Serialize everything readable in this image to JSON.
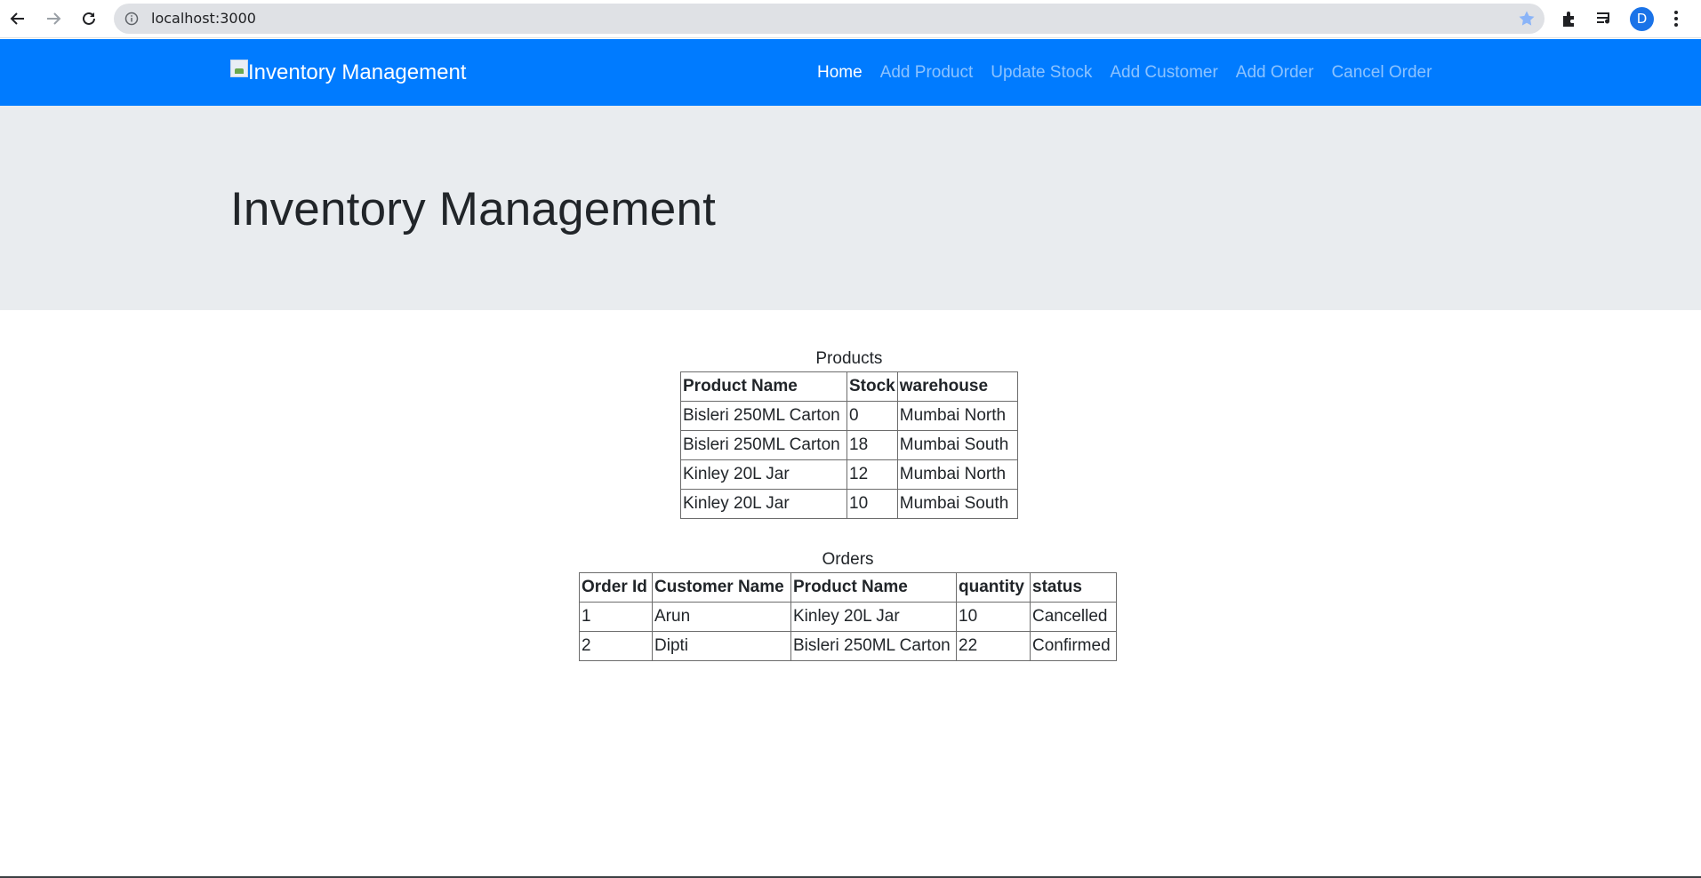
{
  "browser": {
    "url": "localhost:3000",
    "profile_initial": "D"
  },
  "navbar": {
    "brand_alt": "Inventory Management",
    "links": [
      {
        "label": "Home",
        "active": true
      },
      {
        "label": "Add Product",
        "active": false
      },
      {
        "label": "Update Stock",
        "active": false
      },
      {
        "label": "Add Customer",
        "active": false
      },
      {
        "label": "Add Order",
        "active": false
      },
      {
        "label": "Cancel Order",
        "active": false
      }
    ]
  },
  "jumbotron": {
    "title": "Inventory Management"
  },
  "products": {
    "caption": "Products",
    "headers": [
      "Product Name",
      "Stock",
      "warehouse"
    ],
    "rows": [
      [
        "Bisleri 250ML Carton",
        "0",
        "Mumbai North"
      ],
      [
        "Bisleri 250ML Carton",
        "18",
        "Mumbai South"
      ],
      [
        "Kinley 20L Jar",
        "12",
        "Mumbai North"
      ],
      [
        "Kinley 20L Jar",
        "10",
        "Mumbai South"
      ]
    ]
  },
  "orders": {
    "caption": "Orders",
    "headers": [
      "Order Id",
      "Customer Name",
      "Product Name",
      "quantity",
      "status"
    ],
    "rows": [
      [
        "1",
        "Arun",
        "Kinley 20L Jar",
        "10",
        "Cancelled"
      ],
      [
        "2",
        "Dipti",
        "Bisleri 250ML Carton",
        "22",
        "Confirmed"
      ]
    ]
  },
  "colors": {
    "navbar": "#007bff",
    "jumbotron": "#e9ecef"
  }
}
